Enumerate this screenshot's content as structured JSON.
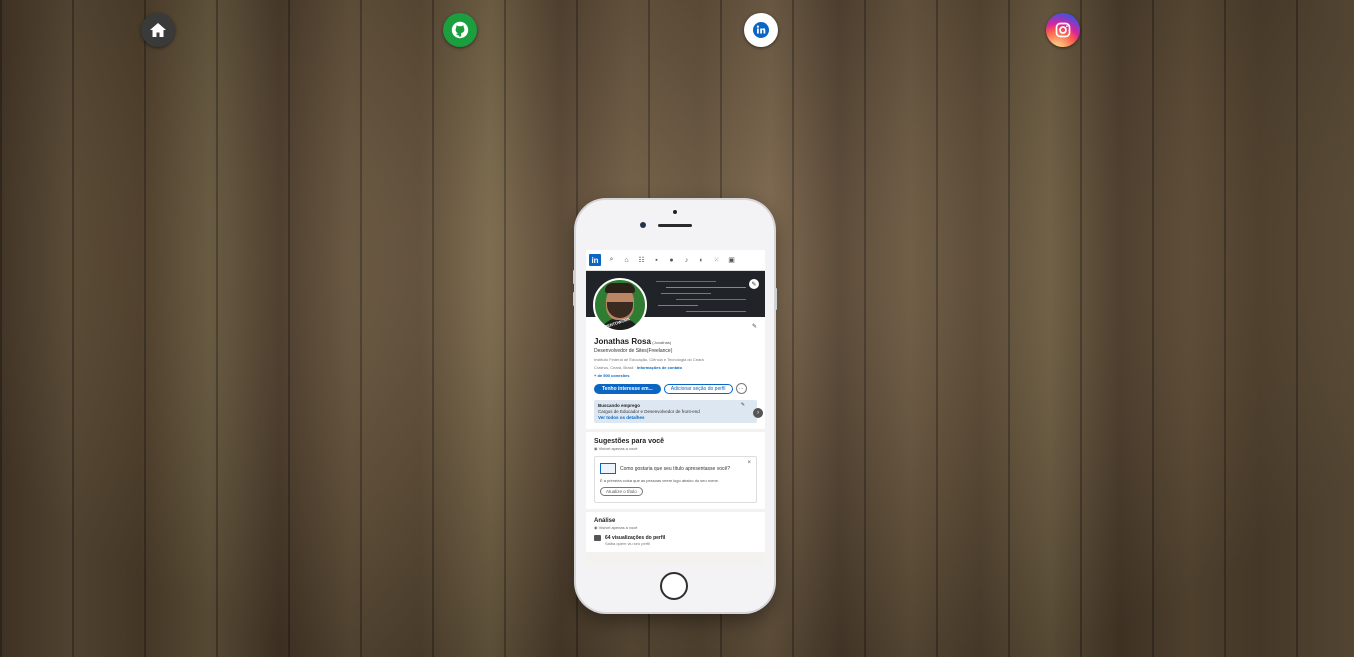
{
  "social": {
    "home_icon": "home-icon",
    "github_icon": "github-icon",
    "linkedin_icon": "linkedin-icon",
    "instagram_icon": "instagram-icon"
  },
  "screen": {
    "nav": {
      "logo": "in"
    },
    "profile": {
      "name": "Jonathas Rosa",
      "pronoun": "(Jonathas)",
      "headline": "Desenvolvedor de Sites(Freelance)",
      "education": "Instituto Federal de Educação, Ciência e Tecnologia do Ceará",
      "location": "Cratéus, Ceará, Brasil",
      "contact_link": "Informações de contato",
      "connections": "+ de 500 conexões",
      "avatar_ring_text": "#OPENTOWORK",
      "primary_button": "Tenho interesse em...",
      "secondary_button": "Adicionar seção do perfil",
      "more_button": "···"
    },
    "open_to_work": {
      "title": "Buscando emprego",
      "roles": "Cargos de Educador e Desenvolvedor de front-end",
      "link": "Ver todos os detalhes"
    },
    "suggestions": {
      "title": "Sugestões para você",
      "visibility": "Visível apenas a você",
      "question": "Como gostaria que seu título apresentasse você?",
      "description": "É a primeira coisa que as pessoas veem logo abaixo do seu nome.",
      "button": "Atualize o título"
    },
    "analytics": {
      "title": "Análise",
      "visibility": "Visível apenas a você",
      "views": "64 visualizações do perfil",
      "views_sub": "Saiba quem viu seu perfil"
    }
  },
  "colors": {
    "linkedin_blue": "#0a66c2",
    "github_green": "#1b9e3e",
    "home_dark": "#3a3a3a"
  }
}
